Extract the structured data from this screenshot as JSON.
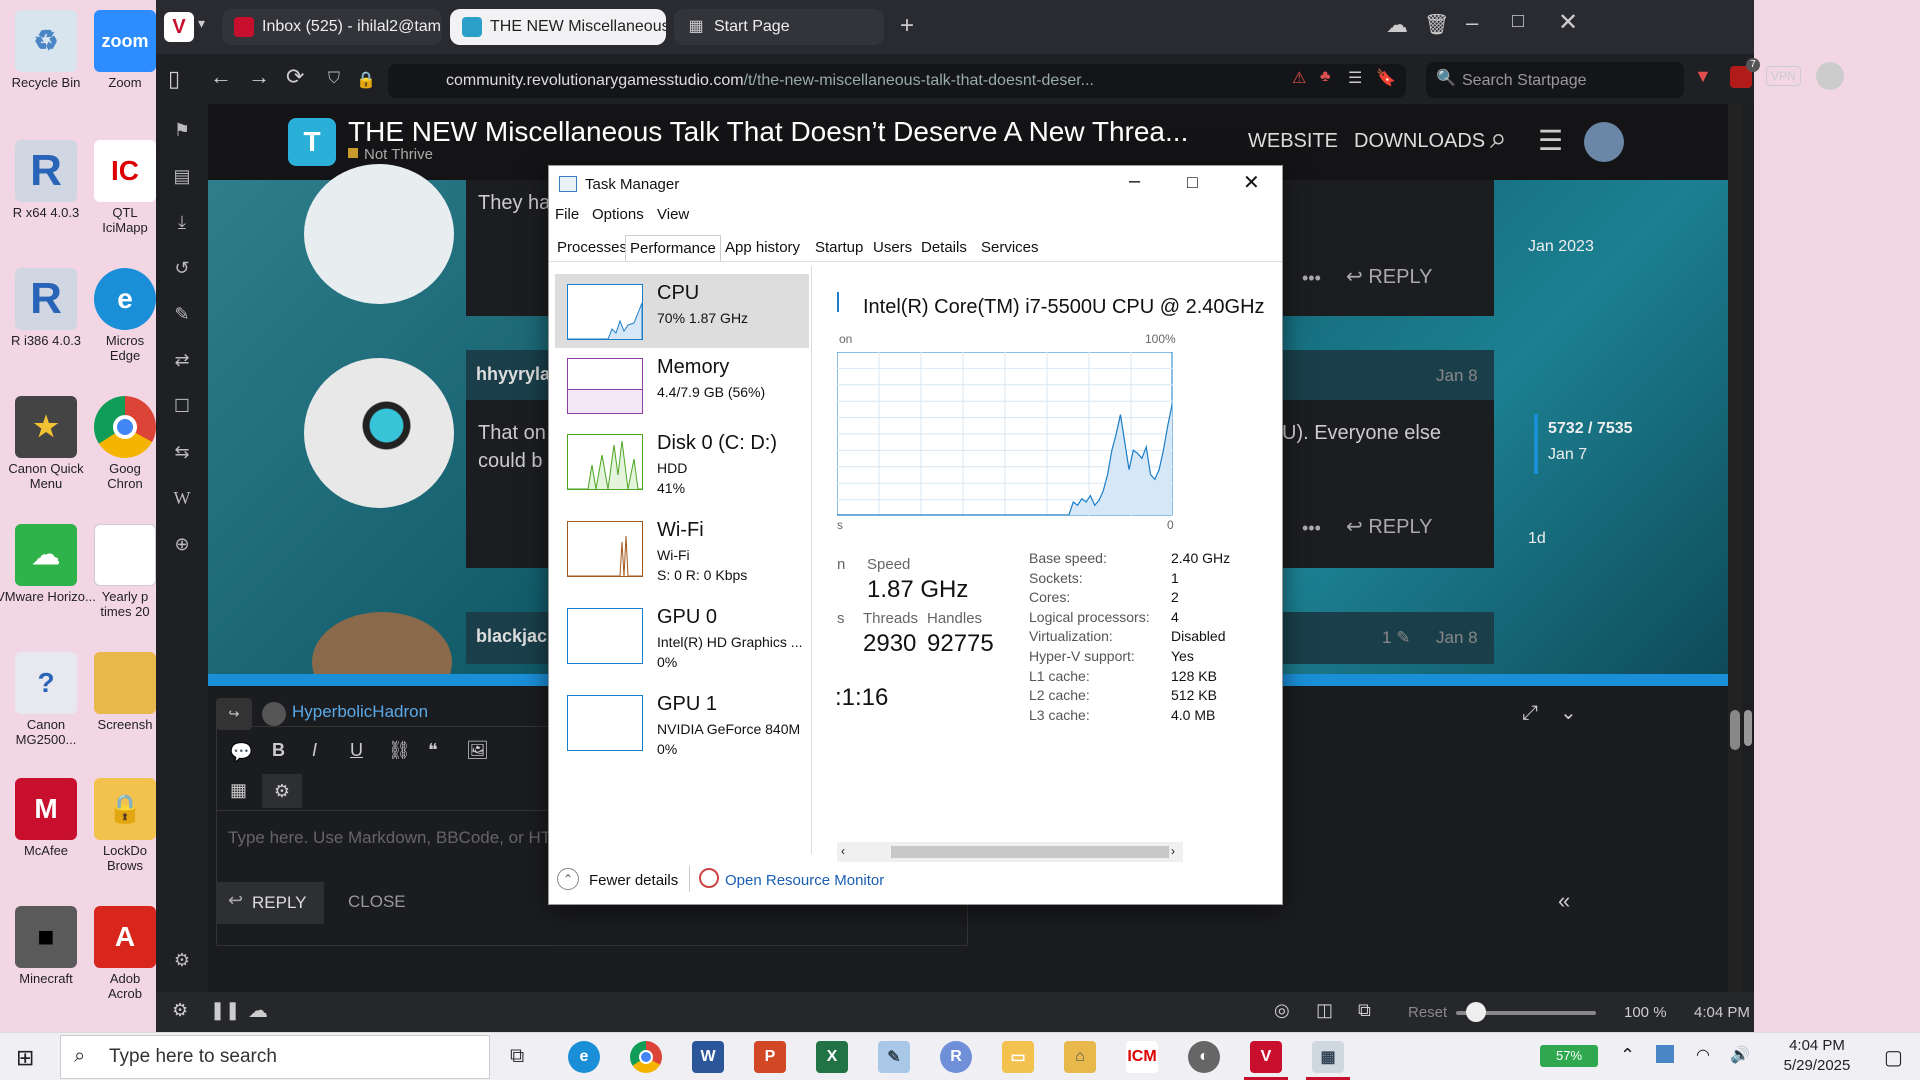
{
  "desktop": {
    "icons": [
      {
        "label": "Recycle Bin"
      },
      {
        "label": "R x64 4.0.3"
      },
      {
        "label": "R i386 4.0.3"
      },
      {
        "label": "Canon Quick Menu"
      },
      {
        "label": "VMware Horizo..."
      },
      {
        "label": "Canon MG2500..."
      },
      {
        "label": "McAfee"
      },
      {
        "label": "Minecraft"
      },
      {
        "label": "Zoom"
      },
      {
        "label": "QTL IciMapp"
      },
      {
        "label": "Micros Edge"
      },
      {
        "label": "Goog Chron"
      },
      {
        "label": "Yearly p times 20"
      },
      {
        "label": "Screensh"
      },
      {
        "label": "LockDo Brows"
      },
      {
        "label": "Adob Acrob"
      }
    ]
  },
  "browser": {
    "tabs": [
      {
        "label": "Inbox (525) - ihilal2@tamu..."
      },
      {
        "label": "THE NEW Miscellaneous Ta"
      },
      {
        "label": "Start Page"
      }
    ],
    "url_host": "community.revolutionarygamesstudio.com",
    "url_path": "/t/the-new-miscellaneous-talk-that-doesnt-deser...",
    "search_placeholder": "Search Startpage",
    "badge_count": "7",
    "vpn_label": "VPN"
  },
  "site": {
    "logo_letter": "T",
    "topic_title": "THE NEW Miscellaneous Talk That Doesn’t Deserve A New Threa...",
    "category": "Not Thrive",
    "nav_website": "WEBSITE",
    "nav_downloads": "DOWNLOADS",
    "post1_text": "They ha",
    "post2_user": "hhyyrylai",
    "post2_date": "Jan 8",
    "post2_text_a": "That on",
    "post2_text_b": "could b",
    "post2_text_right": "U). Everyone else",
    "post3_user": "blackjack",
    "post3_edits": "1",
    "post3_date": "Jan 8",
    "reply_label": "REPLY",
    "timeline": {
      "top": "Jan 2023",
      "position": "5732 / 7535",
      "date": "Jan 7",
      "bottom": "1d"
    },
    "composer": {
      "reply_to": "HyperbolicHadron",
      "placeholder": "Type here. Use Markdown, BBCode, or HT",
      "reply_button": "REPLY",
      "close_button": "CLOSE"
    }
  },
  "statusbar": {
    "reset": "Reset",
    "zoom": "100 %",
    "time": "4:04 PM",
    "zoom_level": 0.14
  },
  "task_manager": {
    "title": "Task Manager",
    "menu": [
      "File",
      "Options",
      "View"
    ],
    "tabs": [
      "Processes",
      "Performance",
      "App history",
      "Startup",
      "Users",
      "Details",
      "Services"
    ],
    "resources": [
      {
        "name": "CPU",
        "sub1": "70% 1.87 GHz",
        "sub2": "",
        "sub3": "",
        "color": "#1a7ec9"
      },
      {
        "name": "Memory",
        "sub1": "4.4/7.9 GB (56%)",
        "sub2": "",
        "sub3": "",
        "color": "#8e3fa8"
      },
      {
        "name": "Disk 0 (C: D:)",
        "sub1": "HDD",
        "sub2": "41%",
        "sub3": "",
        "color": "#4da622"
      },
      {
        "name": "Wi-Fi",
        "sub1": "Wi-Fi",
        "sub2": "S: 0 R: 0 Kbps",
        "sub3": "",
        "color": "#a3581d"
      },
      {
        "name": "GPU 0",
        "sub1": "Intel(R) HD Graphics ...",
        "sub2": "0%",
        "sub3": "",
        "color": "#1a7ec9"
      },
      {
        "name": "GPU 1",
        "sub1": "NVIDIA GeForce 840M",
        "sub2": "0%",
        "sub3": "",
        "color": "#1a7ec9"
      }
    ],
    "cpu_name": "Intel(R) Core(TM) i7-5500U CPU @ 2.40GHz",
    "graph_left_label": "on",
    "graph_max": "100%",
    "graph_min": "0",
    "graph_left_bottom": "s",
    "cpu_usage_history": [
      0,
      0,
      0,
      0,
      0,
      0,
      0,
      0,
      0,
      0,
      0,
      0,
      0,
      0,
      0,
      0,
      0,
      0,
      0,
      0,
      0,
      0,
      0,
      0,
      0,
      0,
      0,
      0,
      0,
      0,
      0,
      0,
      0,
      0,
      0,
      0,
      0,
      0,
      0,
      0,
      0,
      0,
      0,
      0,
      0,
      0,
      0,
      0,
      0,
      0,
      0,
      0,
      0,
      0,
      0,
      8,
      6,
      10,
      8,
      12,
      6,
      9,
      15,
      25,
      40,
      50,
      62,
      45,
      28,
      40,
      38,
      35,
      42,
      25,
      22,
      28,
      40,
      55,
      68
    ],
    "stats": {
      "speed_label": "Speed",
      "speed_value": "1.87 GHz",
      "threads_label": "Threads",
      "threads_value": "2930",
      "handles_label": "Handles",
      "handles_value": "92775",
      "uptime_partial": ":1:16",
      "left_label_1": "n",
      "left_label_2": "s"
    },
    "properties": [
      {
        "label": "Base speed:",
        "value": "2.40 GHz"
      },
      {
        "label": "Sockets:",
        "value": "1"
      },
      {
        "label": "Cores:",
        "value": "2"
      },
      {
        "label": "Logical processors:",
        "value": "4"
      },
      {
        "label": "Virtualization:",
        "value": "Disabled"
      },
      {
        "label": "Hyper-V support:",
        "value": "Yes"
      },
      {
        "label": "L1 cache:",
        "value": "128 KB"
      },
      {
        "label": "L2 cache:",
        "value": "512 KB"
      },
      {
        "label": "L3 cache:",
        "value": "4.0 MB"
      }
    ],
    "fewer_details": "Fewer details",
    "open_resource_monitor": "Open Resource Monitor"
  },
  "taskbar": {
    "search_placeholder": "Type here to search",
    "battery": "57%",
    "time": "4:04 PM",
    "date": "5/29/2025"
  }
}
